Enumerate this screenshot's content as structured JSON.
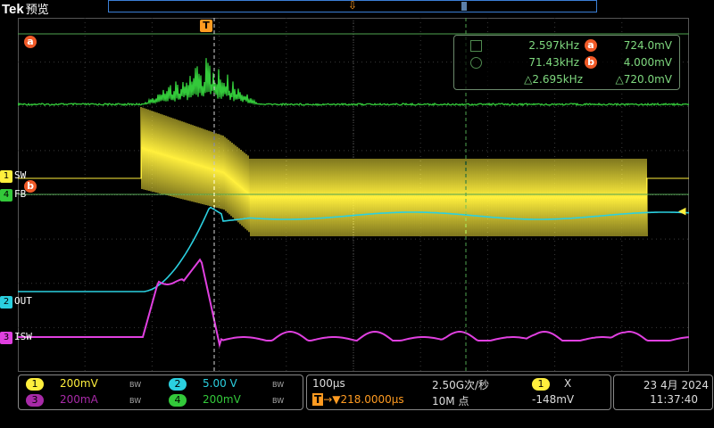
{
  "header": {
    "brand": "Tek",
    "mode": "预览"
  },
  "colors": {
    "ch1": "#ffef3d",
    "ch2": "#2bd0e0",
    "ch3": "#e040e0",
    "ch4": "#33c93a",
    "cursor": "#f05a28",
    "trigger": "#ff9b21"
  },
  "channels": {
    "ch1": {
      "num": "1",
      "label": "SW"
    },
    "ch2": {
      "num": "2",
      "label": "OUT"
    },
    "ch3": {
      "num": "3",
      "label": "ISW"
    },
    "ch4": {
      "num": "4",
      "label": "FB"
    }
  },
  "cursors": {
    "a_label": "a",
    "b_label": "b",
    "a_freq": "2.597kHz",
    "a_value": "724.0mV",
    "b_freq": "71.43kHz",
    "b_value": "4.000mV",
    "delta_freq": "△2.695kHz",
    "delta_value": "△720.0mV"
  },
  "trigger": {
    "label": "T"
  },
  "bottom": {
    "ch1_scale": "200mV",
    "ch2_scale": "5.00 V",
    "ch3_scale": "200mA",
    "ch4_scale": "200mV",
    "bw_label": "BW",
    "timebase": "100µs",
    "trigger_pos": "→▼218.0000µs",
    "sample_rate": "2.50G次/秒",
    "record_length": "10M 点",
    "trig_src": "1",
    "trig_x": "X",
    "trig_level": "-148mV",
    "date": "23 4月 2024",
    "time": "11:37:40"
  }
}
